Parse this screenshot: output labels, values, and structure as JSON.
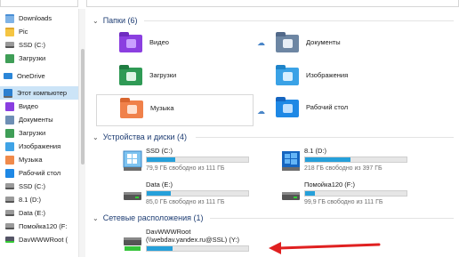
{
  "sidebar": {
    "items": [
      {
        "label": "Downloads",
        "icon": "downloads-folder-icon"
      },
      {
        "label": "Pic",
        "icon": "folder-icon"
      },
      {
        "label": "SSD (C:)",
        "icon": "drive-icon"
      },
      {
        "label": "Загрузки",
        "icon": "downloads-icon"
      },
      {
        "label": "OneDrive",
        "icon": "cloud-icon"
      },
      {
        "label": "Этот компьютер",
        "icon": "computer-icon"
      },
      {
        "label": "Видео",
        "icon": "video-icon"
      },
      {
        "label": "Документы",
        "icon": "documents-icon"
      },
      {
        "label": "Загрузки",
        "icon": "downloads-icon"
      },
      {
        "label": "Изображения",
        "icon": "pictures-icon"
      },
      {
        "label": "Музыка",
        "icon": "music-icon"
      },
      {
        "label": "Рабочий стол",
        "icon": "desktop-icon"
      },
      {
        "label": "SSD (C:)",
        "icon": "drive-icon"
      },
      {
        "label": "8.1 (D:)",
        "icon": "drive-icon"
      },
      {
        "label": "Data (E:)",
        "icon": "drive-icon"
      },
      {
        "label": "Помойка120 (F:",
        "icon": "drive-icon"
      },
      {
        "label": "DavWWWRoot (",
        "icon": "network-drive-icon"
      }
    ],
    "selected": "Этот компьютер"
  },
  "folders": {
    "header": "Папки (6)",
    "items": [
      {
        "name": "Видео",
        "icon": "video-folder-icon"
      },
      {
        "name": "Документы",
        "icon": "documents-folder-icon"
      },
      {
        "name": "Загрузки",
        "icon": "downloads-folder-icon"
      },
      {
        "name": "Изображения",
        "icon": "pictures-folder-icon"
      },
      {
        "name": "Музыка",
        "icon": "music-folder-icon"
      },
      {
        "name": "Рабочий стол",
        "icon": "desktop-folder-icon"
      }
    ]
  },
  "drives": {
    "header": "Устройства и диски (4)",
    "items": [
      {
        "name": "SSD (C:)",
        "free": "79,9 ГБ свободно из 111 ГБ",
        "used_fraction": 0.28
      },
      {
        "name": "8.1 (D:)",
        "free": "218 ГБ свободно из 397 ГБ",
        "used_fraction": 0.45
      },
      {
        "name": "Data (E:)",
        "free": "85,0 ГБ свободно из 111 ГБ",
        "used_fraction": 0.24
      },
      {
        "name": "Помойка120 (F:)",
        "free": "99,9 ГБ свободно из 111 ГБ",
        "used_fraction": 0.1
      }
    ]
  },
  "network": {
    "header": "Сетевые расположения (1)",
    "item": {
      "name": "DavWWWRoot",
      "path": "(\\\\webdav.yandex.ru@SSL) (Y:)",
      "used_fraction": 0.25
    }
  },
  "colors": {
    "accent": "#26a0da",
    "selection": "#cce4f7",
    "arrow": "#e02020",
    "header_text": "#1e3d73"
  }
}
